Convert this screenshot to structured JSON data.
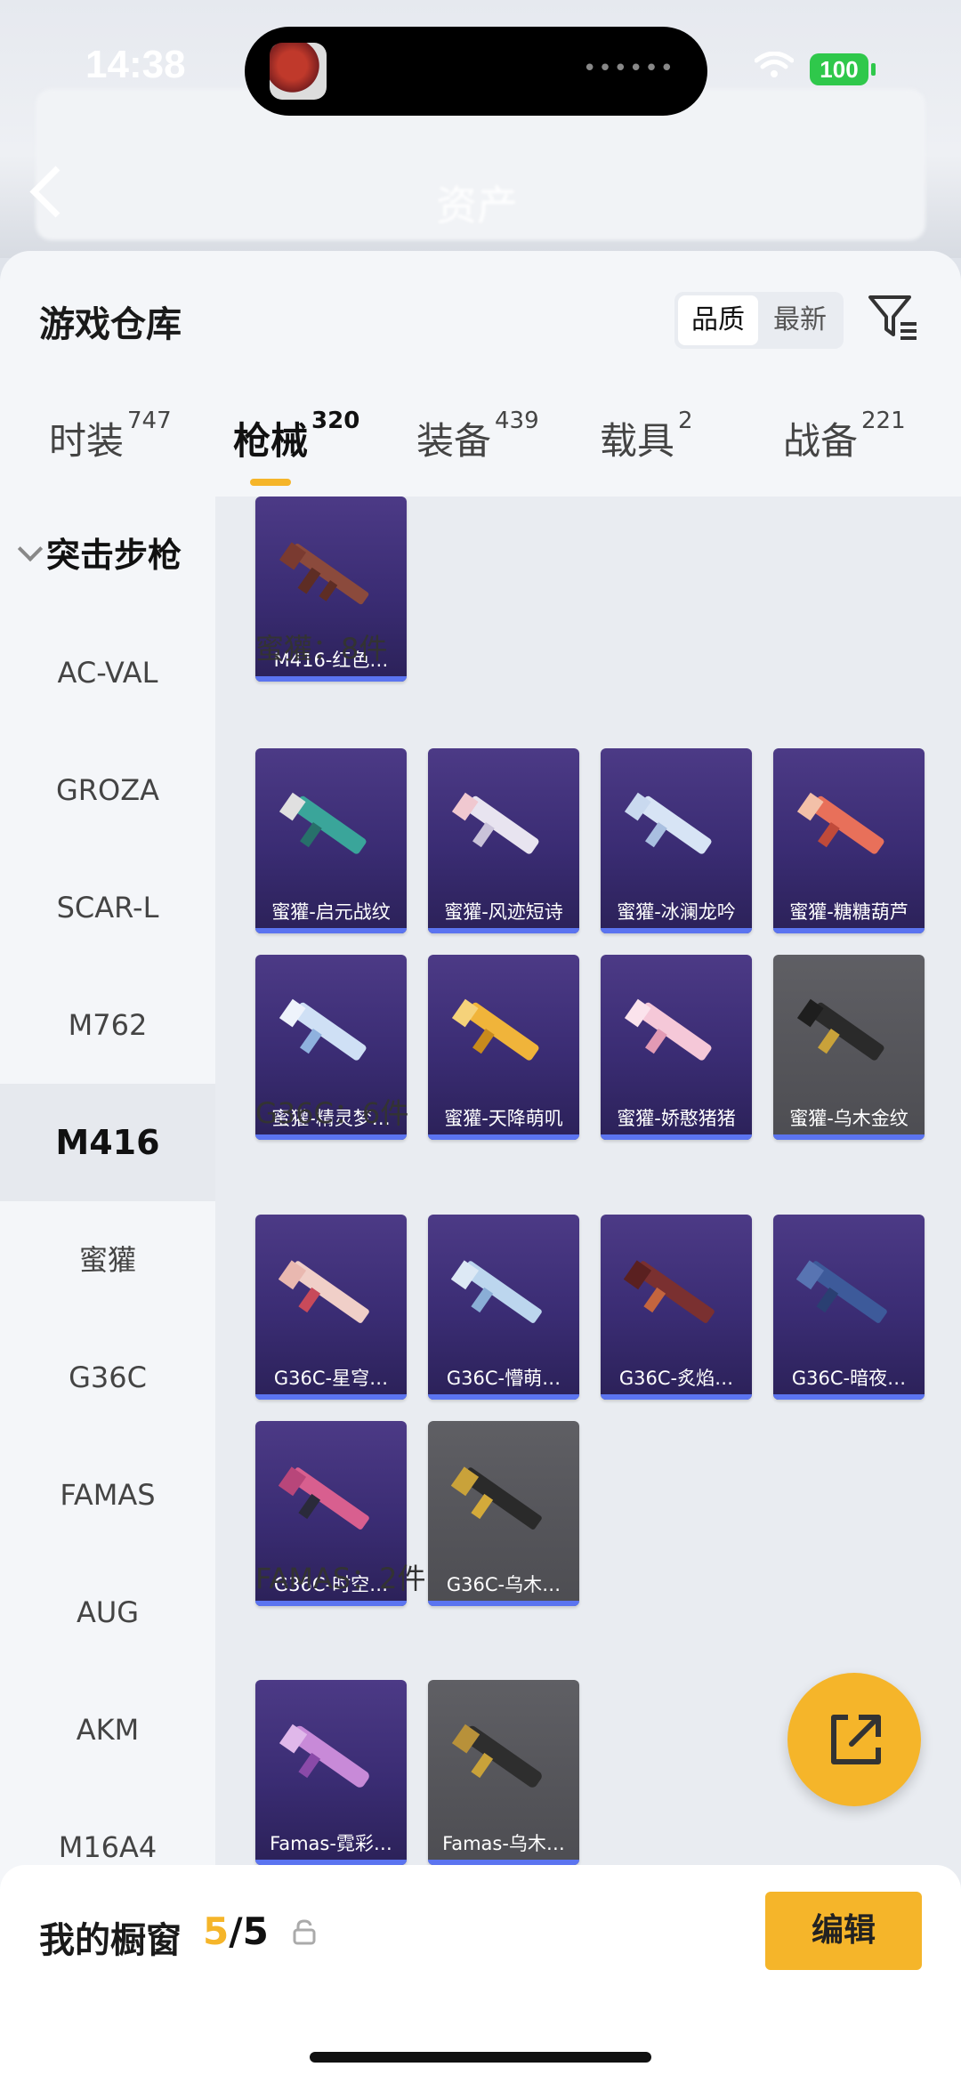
{
  "status": {
    "time": "14:38",
    "battery": "100"
  },
  "background": {
    "title": "资产"
  },
  "header": {
    "title": "游戏仓库",
    "sort_quality": "品质",
    "sort_newest": "最新"
  },
  "tabs": [
    {
      "label": "时装",
      "count": "747"
    },
    {
      "label": "枪械",
      "count": "320",
      "active": true
    },
    {
      "label": "装备",
      "count": "439"
    },
    {
      "label": "载具",
      "count": "2"
    },
    {
      "label": "战备",
      "count": "221"
    }
  ],
  "categories": {
    "group": "突击步枪",
    "items": [
      "AC-VAL",
      "GROZA",
      "SCAR-L",
      "M762",
      "M416",
      "蜜獾",
      "G36C",
      "FAMAS",
      "AUG",
      "AKM",
      "M16A4"
    ],
    "selected": "M416"
  },
  "sections": {
    "m416": {
      "items": [
        "M416-红色…"
      ]
    },
    "honey_badger": {
      "title": "蜜獾：8件",
      "items": [
        "蜜獾-启元战纹",
        "蜜獾-风迹短诗",
        "蜜獾-冰澜龙吟",
        "蜜獾-糖糖葫芦",
        "蜜獾-精灵梦…",
        "蜜獾-天降萌叽",
        "蜜獾-娇憨猪猪",
        "蜜獾-乌木金纹"
      ]
    },
    "g36c": {
      "title": "G36C：6件",
      "items": [
        "G36C-星穹…",
        "G36C-懵萌…",
        "G36C-炙焰…",
        "G36C-暗夜…",
        "G36C-时空…",
        "G36C-乌木…"
      ]
    },
    "famas": {
      "title": "FAMAS：2件",
      "items": [
        "Famas-霓彩…",
        "Famas-乌木…"
      ]
    }
  },
  "showcase": {
    "title": "我的橱窗",
    "used": "5",
    "separator": "/",
    "total": "5",
    "edit_label": "编辑"
  },
  "colors": {
    "accent": "#f5b52a",
    "tile_purple": "#3a2c73",
    "tile_gray": "#4d4d52",
    "tile_bar": "#5b74f0"
  }
}
